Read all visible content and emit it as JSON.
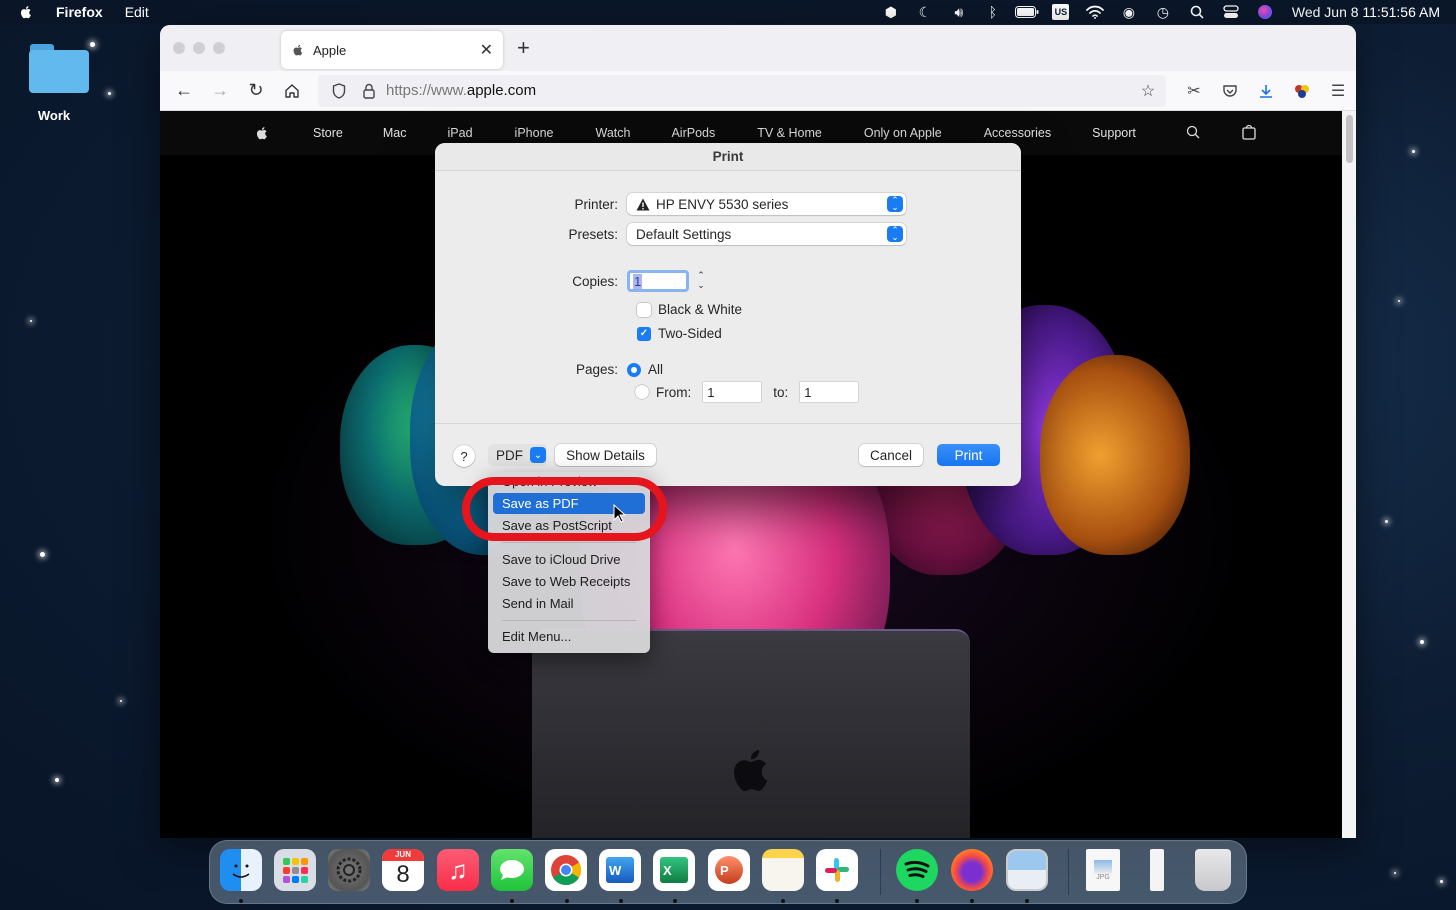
{
  "menubar": {
    "app_name": "Firefox",
    "menus": [
      "Edit"
    ],
    "status_icons": [
      "dropbox-icon",
      "moon-icon",
      "volume-icon",
      "bluetooth-icon",
      "battery-icon",
      "keyboard-input-us",
      "wifi-icon",
      "user-account-icon",
      "time-machine-icon",
      "spotlight-search-icon",
      "control-center-icon",
      "siri-icon"
    ],
    "input_source": "US",
    "clock": "Wed Jun 8  11:51:56 AM"
  },
  "desktop": {
    "folder_label": "Work"
  },
  "browser": {
    "tab_title": "Apple",
    "url_prefix": "https://www.",
    "url_host": "apple.com",
    "new_tab_symbol": "+",
    "tab_close_symbol": "✕"
  },
  "apple_nav": {
    "items": [
      "Store",
      "Mac",
      "iPad",
      "iPhone",
      "Watch",
      "AirPods",
      "TV & Home",
      "Only on Apple",
      "Accessories",
      "Support"
    ]
  },
  "print_dialog": {
    "title": "Print",
    "printer_label": "Printer:",
    "printer_value": "HP ENVY 5530 series",
    "presets_label": "Presets:",
    "presets_value": "Default Settings",
    "copies_label": "Copies:",
    "copies_value": "1",
    "black_white_label": "Black & White",
    "black_white_checked": false,
    "two_sided_label": "Two-Sided",
    "two_sided_checked": true,
    "pages_label": "Pages:",
    "pages_all_label": "All",
    "pages_all_selected": true,
    "pages_from_label": "From:",
    "pages_from_value": "1",
    "pages_to_label": "to:",
    "pages_to_value": "1",
    "help_label": "?",
    "pdf_label": "PDF",
    "show_details_label": "Show Details",
    "cancel_label": "Cancel",
    "print_label": "Print"
  },
  "pdf_menu": {
    "items": [
      {
        "label": "Open in Preview",
        "highlighted": false
      },
      {
        "label": "Save as PDF",
        "highlighted": true
      },
      {
        "label": "Save as PostScript",
        "highlighted": false
      },
      {
        "label": "Save to iCloud Drive",
        "highlighted": false
      },
      {
        "label": "Save to Web Receipts",
        "highlighted": false
      },
      {
        "label": "Send in Mail",
        "highlighted": false
      },
      {
        "label": "Edit Menu...",
        "highlighted": false
      }
    ]
  },
  "dock": {
    "calendar_month": "JUN",
    "calendar_day": "8",
    "apps": [
      "Finder",
      "Launchpad",
      "System Preferences",
      "Calendar",
      "Music",
      "Messages",
      "Google Chrome",
      "Microsoft Word",
      "Microsoft Excel",
      "Microsoft PowerPoint",
      "Notes",
      "Slack",
      "Spotify",
      "Firefox",
      "Preview",
      "JPG file",
      "Document",
      "Trash"
    ],
    "jpg_label": "JPG"
  }
}
